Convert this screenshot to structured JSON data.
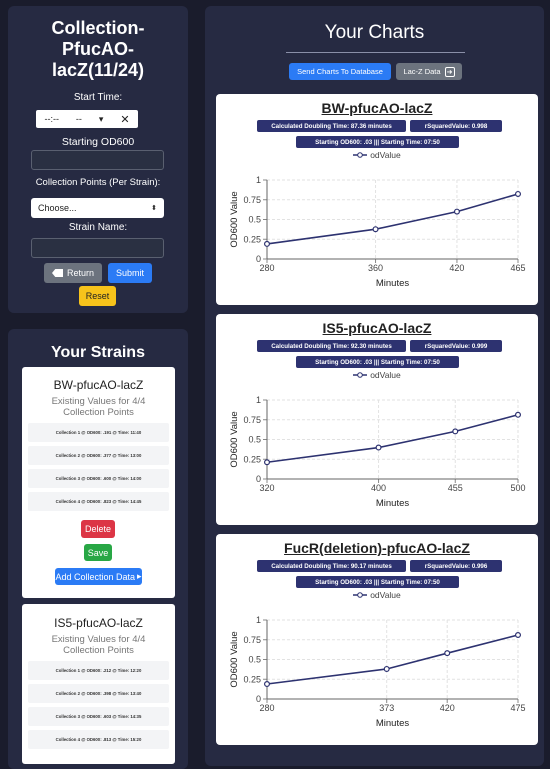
{
  "collection": {
    "title_line1": "Collection-",
    "title_line2": "PfucAO-",
    "title_line3": "lacZ(11/24)",
    "start_time_label": "Start Time:",
    "start_time_value": "--:--",
    "start_time_ampm": "--",
    "clear_glyph": "✕",
    "starting_od_label": "Starting OD600",
    "collection_points_label": "Collection Points (Per Strain):",
    "collection_points_value": "Choose...",
    "strain_name_label": "Strain Name:",
    "return_label": "Return",
    "submit_label": "Submit",
    "reset_label": "Reset"
  },
  "strains": {
    "title": "Your Strains",
    "items": [
      {
        "name": "BW-pfucAO-lacZ",
        "existing_line1": "Existing Values for 4/4",
        "existing_line2": "Collection Points",
        "collections": [
          "Collection 1 @ OD600: .191 @ Time: 11:40",
          "Collection 2 @ OD600: .377 @ Time: 13:00",
          "Collection 3 @ OD600: .600 @ Time: 14:00",
          "Collection 4 @ OD600: .823 @ Time: 14:45"
        ],
        "delete_label": "Delete",
        "save_label": "Save",
        "add_label": "Add Collection Data"
      },
      {
        "name": "IS5-pfucAO-lacZ",
        "existing_line1": "Existing Values for 4/4",
        "existing_line2": "Collection Points",
        "collections": [
          "Collection 1 @ OD600: .212 @ Time: 12:20",
          "Collection 2 @ OD600: .398 @ Time: 13:40",
          "Collection 3 @ OD600: .603 @ Time: 14:35",
          "Collection 4 @ OD600: .813 @ Time: 15:20"
        ]
      }
    ]
  },
  "charts_panel": {
    "title": "Your Charts",
    "send_label": "Send Charts To Database",
    "lacz_label": "Lac-Z Data",
    "colors": {
      "line": "#2d3270",
      "badge": "#2d3270"
    }
  },
  "charts": [
    {
      "title": "BW-pfucAO-lacZ",
      "doubling": "Calculated Doubling Time: 87.36 minutes",
      "rsquared": "rSquaredValue: 0.998",
      "starting": "Starting OD600: .03 ||| Starting Time: 07:50",
      "legend": "odValue",
      "xlabel": "Minutes",
      "ylabel": "OD600 Value",
      "chart_data": {
        "type": "line",
        "series": [
          {
            "name": "odValue",
            "x": [
              280,
              360,
              420,
              465
            ],
            "y": [
              0.191,
              0.377,
              0.6,
              0.823
            ]
          }
        ],
        "x_ticks": [
          "280",
          "360",
          "420",
          "465"
        ],
        "y_ticks": [
          "0",
          "0.25",
          "0.5",
          "0.75",
          "1"
        ],
        "ylim": [
          0,
          1
        ],
        "grid": true
      }
    },
    {
      "title": "IS5-pfucAO-lacZ",
      "doubling": "Calculated Doubling Time: 92.30 minutes",
      "rsquared": "rSquaredValue: 0.999",
      "starting": "Starting OD600: .03 ||| Starting Time: 07:50",
      "legend": "odValue",
      "xlabel": "Minutes",
      "ylabel": "OD600 Value",
      "chart_data": {
        "type": "line",
        "series": [
          {
            "name": "odValue",
            "x": [
              320,
              400,
              455,
              500
            ],
            "y": [
              0.212,
              0.398,
              0.603,
              0.813
            ]
          }
        ],
        "x_ticks": [
          "320",
          "400",
          "455",
          "500"
        ],
        "y_ticks": [
          "0",
          "0.25",
          "0.5",
          "0.75",
          "1"
        ],
        "ylim": [
          0,
          1
        ],
        "grid": true
      }
    },
    {
      "title": "FucR(deletion)-pfucAO-lacZ",
      "doubling": "Calculated Doubling Time: 90.17 minutes",
      "rsquared": "rSquaredValue: 0.996",
      "starting": "Starting OD600: .03 ||| Starting Time: 07:50",
      "legend": "odValue",
      "xlabel": "Minutes",
      "ylabel": "OD600 Value",
      "chart_data": {
        "type": "line",
        "series": [
          {
            "name": "odValue",
            "x": [
              280,
              373,
              420,
              475
            ],
            "y": [
              0.19,
              0.38,
              0.58,
              0.81
            ]
          }
        ],
        "x_ticks": [
          "280",
          "373",
          "420",
          "475"
        ],
        "y_ticks": [
          "0",
          "0.25",
          "0.5",
          "0.75",
          "1"
        ],
        "ylim": [
          0,
          1
        ],
        "grid": true
      }
    }
  ]
}
